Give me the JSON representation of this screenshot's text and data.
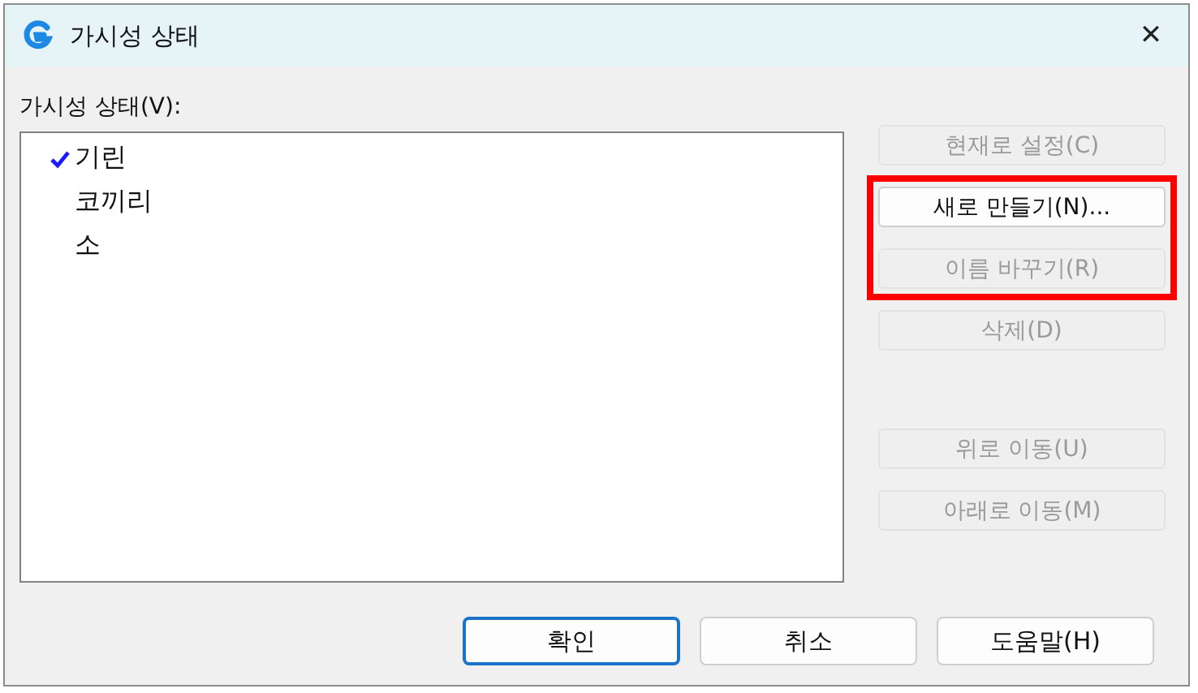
{
  "window": {
    "title": "가시성 상태",
    "close": "✕"
  },
  "list": {
    "label": "가시성 상태(V):",
    "items": [
      {
        "text": "기린",
        "checked": true
      },
      {
        "text": "코끼리",
        "checked": false
      },
      {
        "text": "소",
        "checked": false
      }
    ]
  },
  "side_button_groups": [
    {
      "highlighted": false,
      "buttons": [
        {
          "label": "현재로 설정(C)",
          "disabled": true
        }
      ]
    },
    {
      "highlighted": true,
      "buttons": [
        {
          "label": "새로 만들기(N)...",
          "disabled": false
        },
        {
          "label": "이름 바꾸기(R)",
          "disabled": true
        }
      ]
    },
    {
      "highlighted": false,
      "buttons": [
        {
          "label": "삭제(D)",
          "disabled": true
        }
      ]
    },
    {
      "highlighted": false,
      "buttons": [
        {
          "label": "위로 이동(U)",
          "disabled": true
        },
        {
          "label": "아래로 이동(M)",
          "disabled": true
        }
      ]
    }
  ],
  "buttons": [
    {
      "label": "확인",
      "default": true
    },
    {
      "label": "취소",
      "default": false
    },
    {
      "label": "도움말(H)",
      "default": false
    }
  ]
}
